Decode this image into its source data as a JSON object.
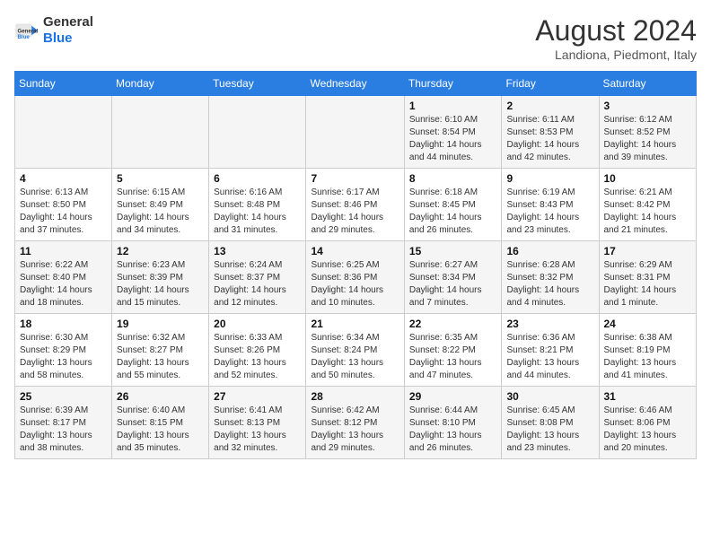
{
  "header": {
    "logo_line1": "General",
    "logo_line2": "Blue",
    "month_year": "August 2024",
    "location": "Landiona, Piedmont, Italy"
  },
  "days_of_week": [
    "Sunday",
    "Monday",
    "Tuesday",
    "Wednesday",
    "Thursday",
    "Friday",
    "Saturday"
  ],
  "weeks": [
    [
      {
        "day": "",
        "info": ""
      },
      {
        "day": "",
        "info": ""
      },
      {
        "day": "",
        "info": ""
      },
      {
        "day": "",
        "info": ""
      },
      {
        "day": "1",
        "info": "Sunrise: 6:10 AM\nSunset: 8:54 PM\nDaylight: 14 hours\nand 44 minutes."
      },
      {
        "day": "2",
        "info": "Sunrise: 6:11 AM\nSunset: 8:53 PM\nDaylight: 14 hours\nand 42 minutes."
      },
      {
        "day": "3",
        "info": "Sunrise: 6:12 AM\nSunset: 8:52 PM\nDaylight: 14 hours\nand 39 minutes."
      }
    ],
    [
      {
        "day": "4",
        "info": "Sunrise: 6:13 AM\nSunset: 8:50 PM\nDaylight: 14 hours\nand 37 minutes."
      },
      {
        "day": "5",
        "info": "Sunrise: 6:15 AM\nSunset: 8:49 PM\nDaylight: 14 hours\nand 34 minutes."
      },
      {
        "day": "6",
        "info": "Sunrise: 6:16 AM\nSunset: 8:48 PM\nDaylight: 14 hours\nand 31 minutes."
      },
      {
        "day": "7",
        "info": "Sunrise: 6:17 AM\nSunset: 8:46 PM\nDaylight: 14 hours\nand 29 minutes."
      },
      {
        "day": "8",
        "info": "Sunrise: 6:18 AM\nSunset: 8:45 PM\nDaylight: 14 hours\nand 26 minutes."
      },
      {
        "day": "9",
        "info": "Sunrise: 6:19 AM\nSunset: 8:43 PM\nDaylight: 14 hours\nand 23 minutes."
      },
      {
        "day": "10",
        "info": "Sunrise: 6:21 AM\nSunset: 8:42 PM\nDaylight: 14 hours\nand 21 minutes."
      }
    ],
    [
      {
        "day": "11",
        "info": "Sunrise: 6:22 AM\nSunset: 8:40 PM\nDaylight: 14 hours\nand 18 minutes."
      },
      {
        "day": "12",
        "info": "Sunrise: 6:23 AM\nSunset: 8:39 PM\nDaylight: 14 hours\nand 15 minutes."
      },
      {
        "day": "13",
        "info": "Sunrise: 6:24 AM\nSunset: 8:37 PM\nDaylight: 14 hours\nand 12 minutes."
      },
      {
        "day": "14",
        "info": "Sunrise: 6:25 AM\nSunset: 8:36 PM\nDaylight: 14 hours\nand 10 minutes."
      },
      {
        "day": "15",
        "info": "Sunrise: 6:27 AM\nSunset: 8:34 PM\nDaylight: 14 hours\nand 7 minutes."
      },
      {
        "day": "16",
        "info": "Sunrise: 6:28 AM\nSunset: 8:32 PM\nDaylight: 14 hours\nand 4 minutes."
      },
      {
        "day": "17",
        "info": "Sunrise: 6:29 AM\nSunset: 8:31 PM\nDaylight: 14 hours\nand 1 minute."
      }
    ],
    [
      {
        "day": "18",
        "info": "Sunrise: 6:30 AM\nSunset: 8:29 PM\nDaylight: 13 hours\nand 58 minutes."
      },
      {
        "day": "19",
        "info": "Sunrise: 6:32 AM\nSunset: 8:27 PM\nDaylight: 13 hours\nand 55 minutes."
      },
      {
        "day": "20",
        "info": "Sunrise: 6:33 AM\nSunset: 8:26 PM\nDaylight: 13 hours\nand 52 minutes."
      },
      {
        "day": "21",
        "info": "Sunrise: 6:34 AM\nSunset: 8:24 PM\nDaylight: 13 hours\nand 50 minutes."
      },
      {
        "day": "22",
        "info": "Sunrise: 6:35 AM\nSunset: 8:22 PM\nDaylight: 13 hours\nand 47 minutes."
      },
      {
        "day": "23",
        "info": "Sunrise: 6:36 AM\nSunset: 8:21 PM\nDaylight: 13 hours\nand 44 minutes."
      },
      {
        "day": "24",
        "info": "Sunrise: 6:38 AM\nSunset: 8:19 PM\nDaylight: 13 hours\nand 41 minutes."
      }
    ],
    [
      {
        "day": "25",
        "info": "Sunrise: 6:39 AM\nSunset: 8:17 PM\nDaylight: 13 hours\nand 38 minutes."
      },
      {
        "day": "26",
        "info": "Sunrise: 6:40 AM\nSunset: 8:15 PM\nDaylight: 13 hours\nand 35 minutes."
      },
      {
        "day": "27",
        "info": "Sunrise: 6:41 AM\nSunset: 8:13 PM\nDaylight: 13 hours\nand 32 minutes."
      },
      {
        "day": "28",
        "info": "Sunrise: 6:42 AM\nSunset: 8:12 PM\nDaylight: 13 hours\nand 29 minutes."
      },
      {
        "day": "29",
        "info": "Sunrise: 6:44 AM\nSunset: 8:10 PM\nDaylight: 13 hours\nand 26 minutes."
      },
      {
        "day": "30",
        "info": "Sunrise: 6:45 AM\nSunset: 8:08 PM\nDaylight: 13 hours\nand 23 minutes."
      },
      {
        "day": "31",
        "info": "Sunrise: 6:46 AM\nSunset: 8:06 PM\nDaylight: 13 hours\nand 20 minutes."
      }
    ]
  ]
}
